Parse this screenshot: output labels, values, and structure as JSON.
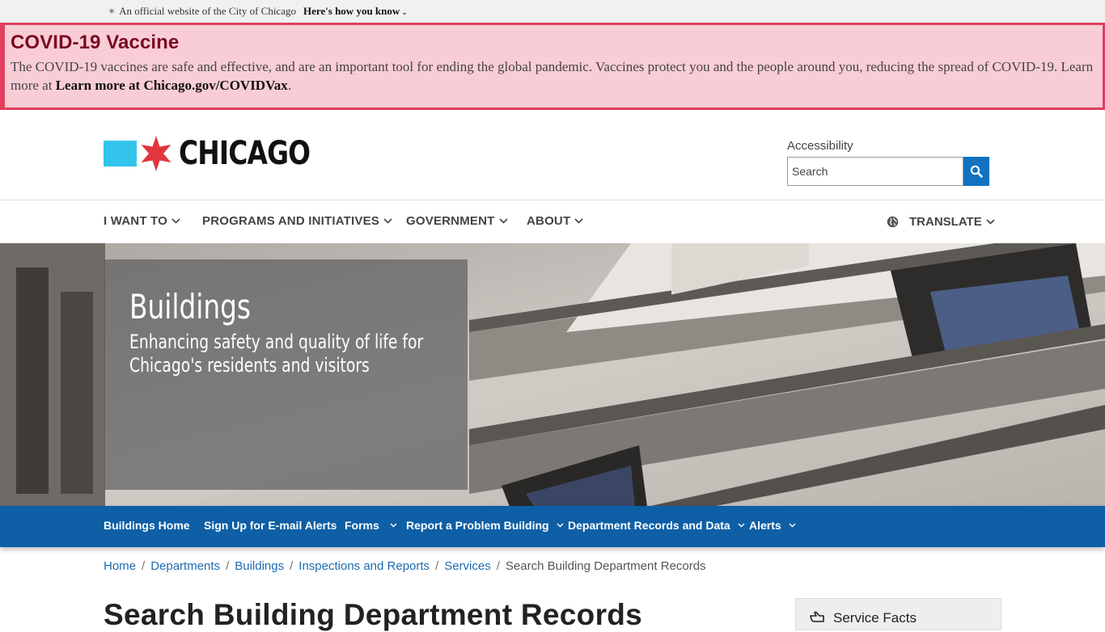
{
  "official": {
    "text": "An official website of the City of Chicago",
    "how": "Here's how you know"
  },
  "alert": {
    "title": "COVID-19 Vaccine",
    "body": "The COVID-19 vaccines are safe and effective, and are an important tool for ending the global pandemic. Vaccines protect you and the people around you, reducing the spread of COVID-19. Learn more at ",
    "link": "Learn more at Chicago.gov/COVIDVax",
    "end": "."
  },
  "header": {
    "logo_text": "CHICAGO",
    "accessibility": "Accessibility",
    "search_placeholder": "Search"
  },
  "nav": {
    "items": [
      {
        "label": "I WANT TO"
      },
      {
        "label": "PROGRAMS AND INITIATIVES"
      },
      {
        "label": "GOVERNMENT"
      },
      {
        "label": "ABOUT"
      }
    ],
    "translate": "TRANSLATE"
  },
  "hero": {
    "title": "Buildings",
    "subtitle": "Enhancing safety and quality of life for Chicago's residents and visitors"
  },
  "subnav": {
    "items": [
      {
        "label": "Buildings Home"
      },
      {
        "label": "Sign Up for E-mail Alerts"
      },
      {
        "label": "Forms"
      },
      {
        "label": "Report a Problem Building"
      },
      {
        "label": "Department Records and Data"
      },
      {
        "label": "Alerts"
      }
    ]
  },
  "breadcrumb": {
    "items": [
      "Home",
      "Departments",
      "Buildings",
      "Inspections and Reports",
      "Services"
    ],
    "current": "Search Building Department Records"
  },
  "page": {
    "title": "Search Building Department Records",
    "service_facts": "Service Facts"
  },
  "colors": {
    "alert_bg": "#f9cdd6",
    "alert_border": "#e0405e",
    "brand_blue": "#33c4ec",
    "brand_red": "#e2363f",
    "subnav_bg": "#0e5fa6",
    "link": "#1d6bb0"
  },
  "icons": {
    "official": "asterisk-icon",
    "search": "magnifier-icon",
    "translate": "globe-icon",
    "facts": "hand-point-icon"
  }
}
